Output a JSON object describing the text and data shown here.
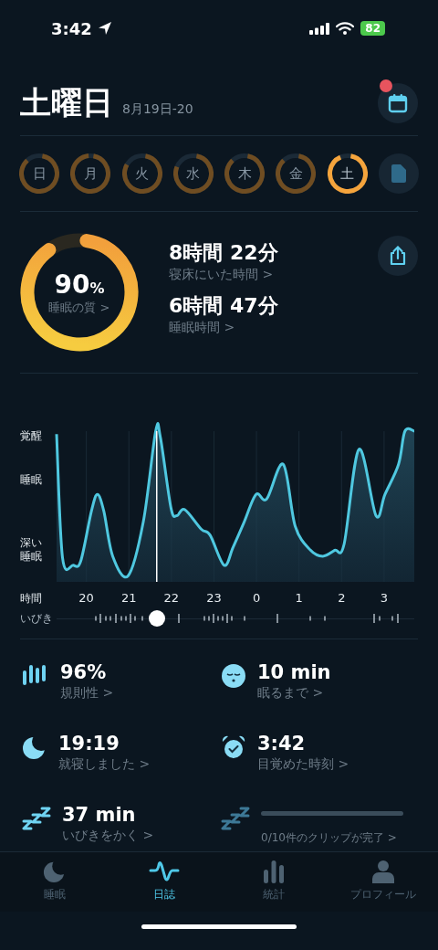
{
  "status_bar": {
    "time": "3:42",
    "battery": "82"
  },
  "header": {
    "title": "土曜日",
    "date_range": "8月19日-20",
    "notification_dot": true
  },
  "days": [
    {
      "label": "日",
      "level": 0.85,
      "selected": false
    },
    {
      "label": "月",
      "level": 0.95,
      "selected": false
    },
    {
      "label": "火",
      "level": 0.8,
      "selected": false
    },
    {
      "label": "水",
      "level": 0.78,
      "selected": false
    },
    {
      "label": "木",
      "level": 0.85,
      "selected": false
    },
    {
      "label": "金",
      "level": 0.85,
      "selected": false
    },
    {
      "label": "土",
      "level": 0.9,
      "selected": true
    }
  ],
  "summary": {
    "quality": {
      "value": "90",
      "unit": "%",
      "label": "睡眠の質 >",
      "level": 0.9
    },
    "stats": [
      {
        "value": "8時間 22分",
        "label": "寝床にいた時間 >"
      },
      {
        "value": "6時間 47分",
        "label": "睡眠時間 >"
      }
    ]
  },
  "sleep_chart": {
    "stage_labels": [
      "覚醒",
      "睡眠",
      "深い睡眠"
    ],
    "axis_title": "時間",
    "hour_labels": [
      "20",
      "21",
      "22",
      "23",
      "0",
      "1",
      "2",
      "3"
    ],
    "snore": {
      "label": "いびき",
      "level": 0.28
    }
  },
  "metrics": [
    {
      "kind": "regularity",
      "value": "96%",
      "label": "規則性 >"
    },
    {
      "kind": "fall_asleep",
      "value": "10 min",
      "label": "眠るまで >"
    },
    {
      "kind": "bedtime",
      "value": "19:19",
      "label": "就寝しました >"
    },
    {
      "kind": "wake",
      "value": "3:42",
      "label": "目覚めた時刻 >"
    },
    {
      "kind": "snoring",
      "value": "37 min",
      "label": "いびきをかく >"
    },
    {
      "kind": "clips",
      "level": 0,
      "label": "0/10件のクリップが完了 >"
    }
  ],
  "tab_bar": [
    {
      "label": "睡眠",
      "kind": "moon",
      "selected": false
    },
    {
      "label": "日誌",
      "kind": "wave",
      "selected": true
    },
    {
      "label": "統計",
      "kind": "bars",
      "selected": false
    },
    {
      "label": "プロフィール",
      "kind": "person",
      "selected": false
    }
  ]
}
